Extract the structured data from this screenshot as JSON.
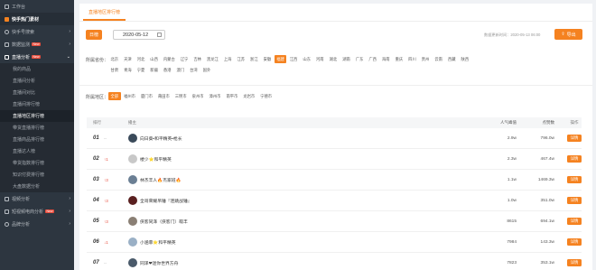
{
  "sidebar": {
    "top_item": "工作台",
    "section_hot": "快手热门素材",
    "items": [
      {
        "label": "快手号搜索",
        "arrow": "›"
      },
      {
        "label": "数据监测",
        "arrow": "›",
        "badge": "New"
      }
    ],
    "section_live": "直播分析",
    "section_live_badge": "New",
    "sub_items": [
      "我的商品",
      "直播间分析",
      "直播间对比",
      "直播间排行榜",
      "直播地区排行榜",
      "带货直播排行榜",
      "直播商品排行榜",
      "直播达人榜",
      "带货指数排行榜",
      "知识付费排行榜",
      "大盘数据分析"
    ],
    "section_bottom": [
      {
        "label": "视频分析",
        "arrow": "›"
      },
      {
        "label": "短视频电商分析",
        "arrow": "›",
        "badge": "New"
      },
      {
        "label": "品牌分析",
        "arrow": "›"
      }
    ]
  },
  "tab": {
    "label": "直播地区排行榜"
  },
  "toolbar": {
    "day_button": "日榜",
    "date_value": "2020-05-12",
    "update_time": "数据更新时间：2020-05-13 06:00",
    "export_button": "导出"
  },
  "province_filter": {
    "label": "所属省份：",
    "selected": "福建",
    "options_row1": [
      "北京",
      "天津",
      "河北",
      "山西",
      "内蒙古",
      "辽宁",
      "吉林",
      "黑龙江",
      "上海",
      "江苏",
      "浙江",
      "安徽",
      "福建",
      "江西",
      "山东",
      "河南",
      "湖北",
      "湖南",
      "广东",
      "广西",
      "海南",
      "重庆",
      "四川",
      "贵州",
      "云南",
      "西藏",
      "陕西"
    ],
    "options_row2": [
      "甘肃",
      "青海",
      "宁夏",
      "新疆",
      "香港",
      "澳门",
      "台湾",
      "国外"
    ]
  },
  "region_filter": {
    "label": "所属地区：",
    "selected": "全部",
    "options": [
      "全部",
      "福州市",
      "厦门市",
      "莆田市",
      "三明市",
      "泉州市",
      "漳州市",
      "南平市",
      "龙岩市",
      "宁德市"
    ]
  },
  "table": {
    "headers": {
      "rank": "排行",
      "anchor": "播主",
      "popularity": "人气峰值",
      "likes": "点赞数",
      "operation": "操作"
    },
    "detail_label": "详情",
    "rows": [
      {
        "rank": "01",
        "trend": "--",
        "trend_type": "flat",
        "name": "向日葵•和平精英•枪长",
        "popularity": "2.9w",
        "likes": "796.0w",
        "avatar_color": "#3a4a5a"
      },
      {
        "rank": "02",
        "trend": "↑1",
        "trend_type": "up",
        "name": "楼少⭐和平精英",
        "popularity": "2.3w",
        "likes": "467.4w",
        "avatar_color": "#c8c8c8"
      },
      {
        "rank": "03",
        "trend": "↑3",
        "trend_type": "up",
        "name": "林杰丰人🔥杰家班🔥",
        "popularity": "1.1w",
        "likes": "1469.3w",
        "avatar_color": "#6b7f94"
      },
      {
        "rank": "04",
        "trend": "↑3",
        "trend_type": "up",
        "name": "全哥荣耀吊锤『连跳战锤』",
        "popularity": "1.0w",
        "likes": "351.0w",
        "avatar_color": "#5a2020"
      },
      {
        "rank": "05",
        "trend": "↑3",
        "trend_type": "up",
        "name": "侠客同泽（侠客门）萌丰",
        "popularity": "8615",
        "likes": "694.1w",
        "avatar_color": "#8a7f74"
      },
      {
        "rank": "06",
        "trend": "↓1",
        "trend_type": "up",
        "name": "小涵菲⭐和平精英",
        "popularity": "7984",
        "likes": "143.3w",
        "avatar_color": "#9ab0c6"
      },
      {
        "rank": "07",
        "trend": "--",
        "trend_type": "flat",
        "name": "同泽❤迷你世界方舟",
        "popularity": "7823",
        "likes": "353.1w",
        "avatar_color": "#4a5a6a"
      }
    ]
  },
  "colors": {
    "accent": "#f58220",
    "sidebar_bg": "#2d3640",
    "up": "#e74c3c"
  }
}
